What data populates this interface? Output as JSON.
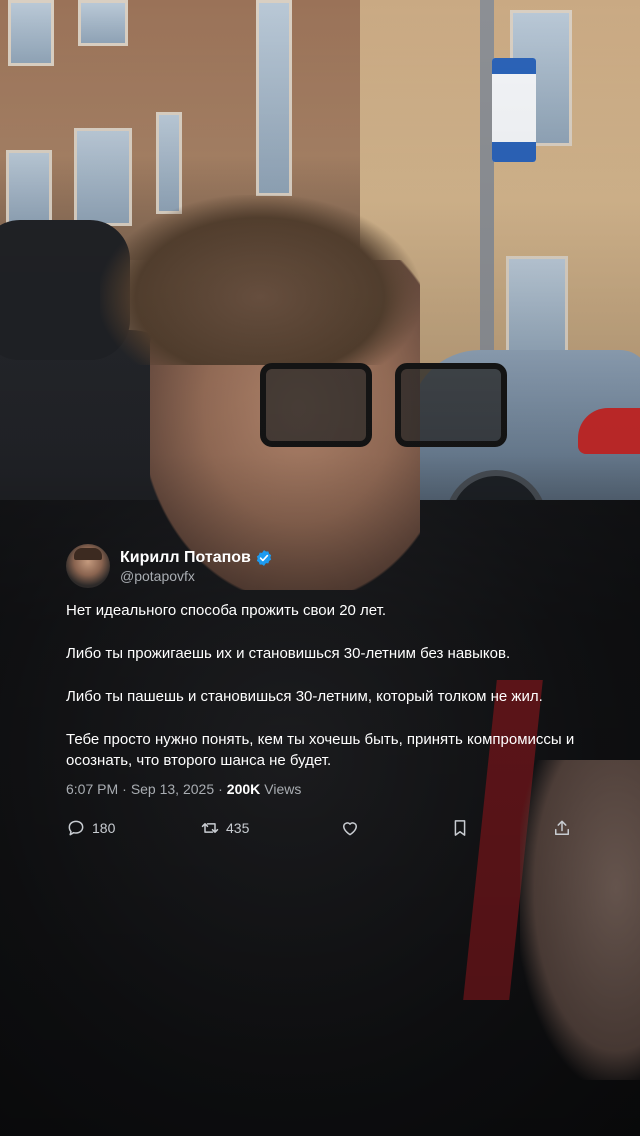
{
  "tweet": {
    "display_name": "Кирилл Потапов",
    "handle": "@potapovfx",
    "verified": true,
    "paragraphs": [
      "Нет идеального способа прожить свои 20 лет.",
      "Либо ты прожигаешь их и становишься 30-летним без навыков.",
      "Либо ты пашешь и становишься 30-летним, который толком не жил.",
      "Тебе просто нужно понять, кем ты хочешь быть, принять компромиссы и осознать, что второго шанса не будет."
    ],
    "time": "6:07 PM",
    "separator": "·",
    "date": "Sep 13, 2025",
    "views_count": "200K",
    "views_label": "Views",
    "replies": "180",
    "retweets": "435"
  },
  "colors": {
    "text": "#ffffff",
    "muted": "#a9adb2",
    "verified": "#1d9bf0",
    "icon": "#c8ccd1"
  },
  "icons": {
    "reply": "speech-bubble-icon",
    "retweet": "retweet-icon",
    "like": "heart-icon",
    "bookmark": "bookmark-icon",
    "share": "share-icon",
    "verified": "verified-badge-icon"
  }
}
